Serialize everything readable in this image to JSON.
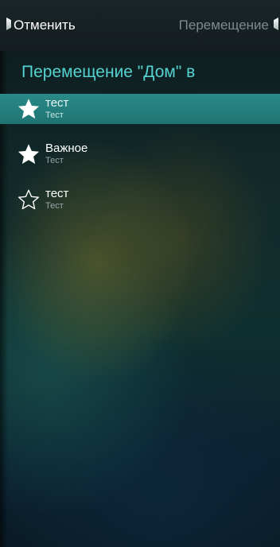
{
  "topbar": {
    "cancel_label": "Отменить",
    "title": "Перемещение"
  },
  "header": {
    "title": "Перемещение \"Дом\" в"
  },
  "items": [
    {
      "label": "тест",
      "sub": "Тест",
      "icon": "star-filled-icon",
      "selected": true
    },
    {
      "label": "Важное",
      "sub": "Тест",
      "icon": "star-filled-icon",
      "selected": false
    },
    {
      "label": "тест",
      "sub": "Тест",
      "icon": "star-outline-icon",
      "selected": false
    }
  ],
  "colors": {
    "accent": "#54d3d0",
    "selected_row": "#268382",
    "top_title": "#7d8a8c"
  }
}
